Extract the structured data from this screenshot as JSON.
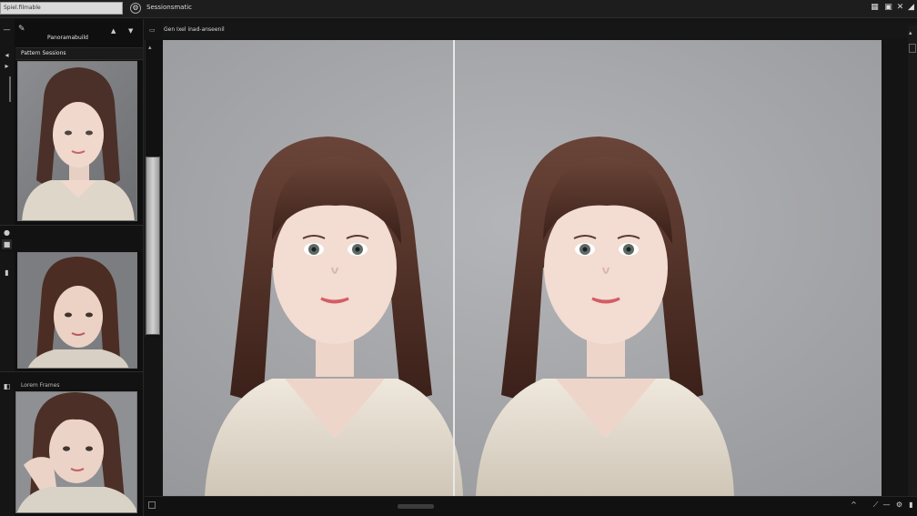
{
  "topbar": {
    "search_value": "Spiel.filmable",
    "app_icon": "gear-icon",
    "title": "Sessionsmatic",
    "right_icons": [
      "grid-icon",
      "image-icon",
      "close-icon",
      "expand-icon"
    ]
  },
  "left_panel": {
    "header_label": "Panoramabuild",
    "section1_label": "Pattern Sessions",
    "section3_label": "Lorem Frames",
    "thumbnails": [
      {
        "name": "portrait-thumbnail-1"
      },
      {
        "name": "portrait-thumbnail-2"
      },
      {
        "name": "portrait-thumbnail-3"
      }
    ]
  },
  "main": {
    "header_text": "Gen  Ixel  inad-anseenil",
    "viewer": {
      "left_image": "portrait-left",
      "right_image": "portrait-right"
    }
  },
  "colors": {
    "background": "#141414",
    "viewer_backdrop": "#a5a6a9",
    "accent": "#e8e8e8"
  }
}
